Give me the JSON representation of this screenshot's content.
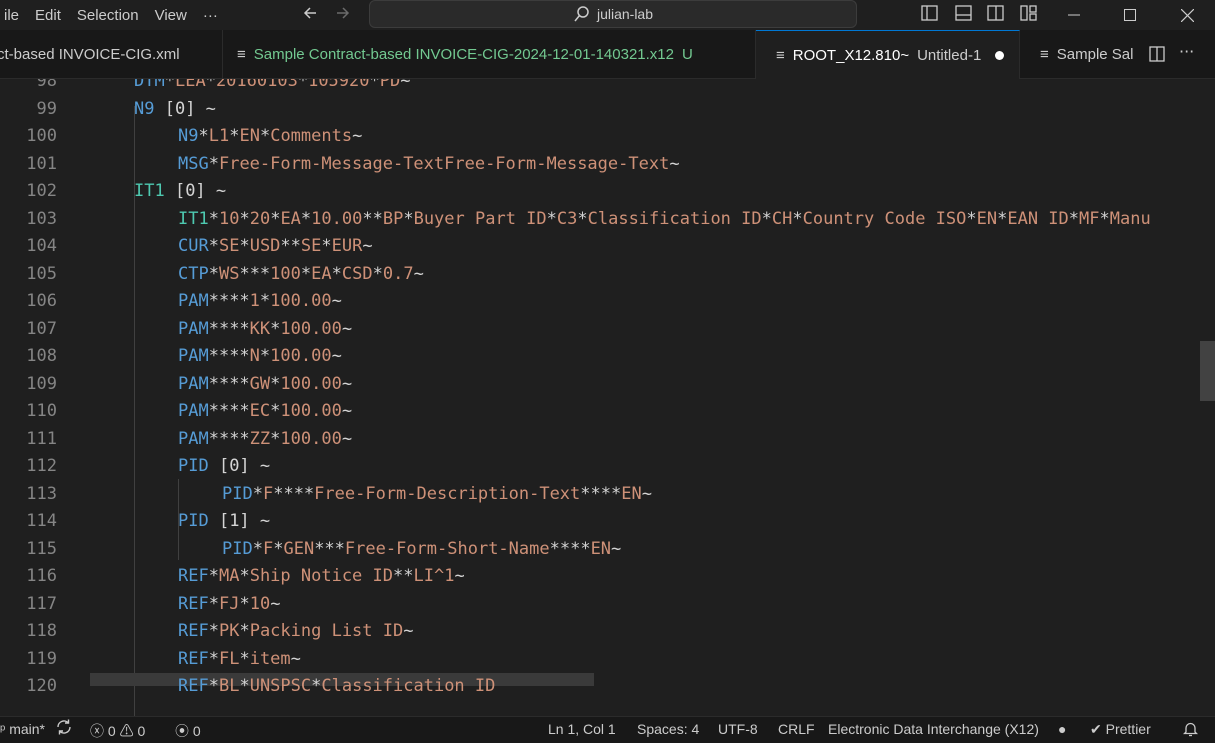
{
  "menu": {
    "file": "ile",
    "edit": "Edit",
    "selection": "Selection",
    "view": "View",
    "more": "···"
  },
  "search": {
    "text": "julian-lab"
  },
  "tabs": [
    {
      "label": "ct-based INVOICE-CIG.xml",
      "color": "#cccccc"
    },
    {
      "label": "Sample Contract-based INVOICE-CIG-2024-12-01-140321.x12",
      "badge": "U",
      "color": "#73c991"
    },
    {
      "label": "ROOT_X12.810~",
      "sub": "Untitled-1",
      "color": "#ffffff"
    },
    {
      "label": "Sample Sal",
      "color": "#cccccc"
    }
  ],
  "editor": {
    "lines": [
      {
        "n": "98",
        "segs": [
          [
            "seg",
            "DTM"
          ],
          [
            "sep",
            "*"
          ],
          [
            "tok",
            "LEA"
          ],
          [
            "sep",
            "*"
          ],
          [
            "tok",
            "20160103"
          ],
          [
            "sep",
            "*"
          ],
          [
            "tok",
            "105920"
          ],
          [
            "sep",
            "*"
          ],
          [
            "tok",
            "PD"
          ],
          [
            "sep",
            "~"
          ]
        ]
      },
      {
        "n": "99",
        "segs": [
          [
            "seg",
            "N9"
          ],
          [
            "sep",
            " [0] ~"
          ]
        ]
      },
      {
        "n": "100",
        "segs": [
          [
            "seg",
            "N9"
          ],
          [
            "sep",
            "*"
          ],
          [
            "tok",
            "L1"
          ],
          [
            "sep",
            "*"
          ],
          [
            "tok",
            "EN"
          ],
          [
            "sep",
            "*"
          ],
          [
            "tok",
            "Comments"
          ],
          [
            "sep",
            "~"
          ]
        ]
      },
      {
        "n": "101",
        "segs": [
          [
            "seg",
            "MSG"
          ],
          [
            "sep",
            "*"
          ],
          [
            "tok",
            "Free-Form-Message-TextFree-Form-Message-Text"
          ],
          [
            "sep",
            "~"
          ]
        ]
      },
      {
        "n": "102",
        "segs": [
          [
            "id",
            "IT1"
          ],
          [
            "sep",
            " [0] ~"
          ]
        ]
      },
      {
        "n": "103",
        "segs": [
          [
            "id",
            "IT1"
          ],
          [
            "sep",
            "*"
          ],
          [
            "tok",
            "10"
          ],
          [
            "sep",
            "*"
          ],
          [
            "tok",
            "20"
          ],
          [
            "sep",
            "*"
          ],
          [
            "tok",
            "EA"
          ],
          [
            "sep",
            "*"
          ],
          [
            "tok",
            "10.00"
          ],
          [
            "sep",
            "**"
          ],
          [
            "tok",
            "BP"
          ],
          [
            "sep",
            "*"
          ],
          [
            "tok",
            "Buyer Part ID"
          ],
          [
            "sep",
            "*"
          ],
          [
            "tok",
            "C3"
          ],
          [
            "sep",
            "*"
          ],
          [
            "tok",
            "Classification ID"
          ],
          [
            "sep",
            "*"
          ],
          [
            "tok",
            "CH"
          ],
          [
            "sep",
            "*"
          ],
          [
            "tok",
            "Country Code ISO"
          ],
          [
            "sep",
            "*"
          ],
          [
            "tok",
            "EN"
          ],
          [
            "sep",
            "*"
          ],
          [
            "tok",
            "EAN ID"
          ],
          [
            "sep",
            "*"
          ],
          [
            "tok",
            "MF"
          ],
          [
            "sep",
            "*"
          ],
          [
            "tok",
            "Manu"
          ]
        ]
      },
      {
        "n": "104",
        "segs": [
          [
            "seg",
            "CUR"
          ],
          [
            "sep",
            "*"
          ],
          [
            "tok",
            "SE"
          ],
          [
            "sep",
            "*"
          ],
          [
            "tok",
            "USD"
          ],
          [
            "sep",
            "**"
          ],
          [
            "tok",
            "SE"
          ],
          [
            "sep",
            "*"
          ],
          [
            "tok",
            "EUR"
          ],
          [
            "sep",
            "~"
          ]
        ]
      },
      {
        "n": "105",
        "segs": [
          [
            "seg",
            "CTP"
          ],
          [
            "sep",
            "*"
          ],
          [
            "tok",
            "WS"
          ],
          [
            "sep",
            "***"
          ],
          [
            "tok",
            "100"
          ],
          [
            "sep",
            "*"
          ],
          [
            "tok",
            "EA"
          ],
          [
            "sep",
            "*"
          ],
          [
            "tok",
            "CSD"
          ],
          [
            "sep",
            "*"
          ],
          [
            "tok",
            "0.7"
          ],
          [
            "sep",
            "~"
          ]
        ]
      },
      {
        "n": "106",
        "segs": [
          [
            "seg",
            "PAM"
          ],
          [
            "sep",
            "****"
          ],
          [
            "tok",
            "1"
          ],
          [
            "sep",
            "*"
          ],
          [
            "tok",
            "100.00"
          ],
          [
            "sep",
            "~"
          ]
        ]
      },
      {
        "n": "107",
        "segs": [
          [
            "seg",
            "PAM"
          ],
          [
            "sep",
            "****"
          ],
          [
            "tok",
            "KK"
          ],
          [
            "sep",
            "*"
          ],
          [
            "tok",
            "100.00"
          ],
          [
            "sep",
            "~"
          ]
        ]
      },
      {
        "n": "108",
        "segs": [
          [
            "seg",
            "PAM"
          ],
          [
            "sep",
            "****"
          ],
          [
            "tok",
            "N"
          ],
          [
            "sep",
            "*"
          ],
          [
            "tok",
            "100.00"
          ],
          [
            "sep",
            "~"
          ]
        ]
      },
      {
        "n": "109",
        "segs": [
          [
            "seg",
            "PAM"
          ],
          [
            "sep",
            "****"
          ],
          [
            "tok",
            "GW"
          ],
          [
            "sep",
            "*"
          ],
          [
            "tok",
            "100.00"
          ],
          [
            "sep",
            "~"
          ]
        ]
      },
      {
        "n": "110",
        "segs": [
          [
            "seg",
            "PAM"
          ],
          [
            "sep",
            "****"
          ],
          [
            "tok",
            "EC"
          ],
          [
            "sep",
            "*"
          ],
          [
            "tok",
            "100.00"
          ],
          [
            "sep",
            "~"
          ]
        ]
      },
      {
        "n": "111",
        "segs": [
          [
            "seg",
            "PAM"
          ],
          [
            "sep",
            "****"
          ],
          [
            "tok",
            "ZZ"
          ],
          [
            "sep",
            "*"
          ],
          [
            "tok",
            "100.00"
          ],
          [
            "sep",
            "~"
          ]
        ]
      },
      {
        "n": "112",
        "segs": [
          [
            "seg",
            "PID"
          ],
          [
            "sep",
            " [0] ~"
          ]
        ]
      },
      {
        "n": "113",
        "segs": [
          [
            "seg",
            "PID"
          ],
          [
            "sep",
            "*"
          ],
          [
            "tok",
            "F"
          ],
          [
            "sep",
            "****"
          ],
          [
            "tok",
            "Free-Form-Description-Text"
          ],
          [
            "sep",
            "****"
          ],
          [
            "tok",
            "EN"
          ],
          [
            "sep",
            "~"
          ]
        ]
      },
      {
        "n": "114",
        "segs": [
          [
            "seg",
            "PID"
          ],
          [
            "sep",
            " [1] ~"
          ]
        ]
      },
      {
        "n": "115",
        "segs": [
          [
            "seg",
            "PID"
          ],
          [
            "sep",
            "*"
          ],
          [
            "tok",
            "F"
          ],
          [
            "sep",
            "*"
          ],
          [
            "tok",
            "GEN"
          ],
          [
            "sep",
            "***"
          ],
          [
            "tok",
            "Free-Form-Short-Name"
          ],
          [
            "sep",
            "****"
          ],
          [
            "tok",
            "EN"
          ],
          [
            "sep",
            "~"
          ]
        ]
      },
      {
        "n": "116",
        "segs": [
          [
            "seg",
            "REF"
          ],
          [
            "sep",
            "*"
          ],
          [
            "tok",
            "MA"
          ],
          [
            "sep",
            "*"
          ],
          [
            "tok",
            "Ship Notice ID"
          ],
          [
            "sep",
            "**"
          ],
          [
            "tok",
            "LI^1"
          ],
          [
            "sep",
            "~"
          ]
        ]
      },
      {
        "n": "117",
        "segs": [
          [
            "seg",
            "REF"
          ],
          [
            "sep",
            "*"
          ],
          [
            "tok",
            "FJ"
          ],
          [
            "sep",
            "*"
          ],
          [
            "tok",
            "10"
          ],
          [
            "sep",
            "~"
          ]
        ]
      },
      {
        "n": "118",
        "segs": [
          [
            "seg",
            "REF"
          ],
          [
            "sep",
            "*"
          ],
          [
            "tok",
            "PK"
          ],
          [
            "sep",
            "*"
          ],
          [
            "tok",
            "Packing List ID"
          ],
          [
            "sep",
            "~"
          ]
        ]
      },
      {
        "n": "119",
        "segs": [
          [
            "seg",
            "REF"
          ],
          [
            "sep",
            "*"
          ],
          [
            "tok",
            "FL"
          ],
          [
            "sep",
            "*"
          ],
          [
            "tok",
            "item"
          ],
          [
            "sep",
            "~"
          ]
        ]
      },
      {
        "n": "120",
        "segs": [
          [
            "seg",
            "REF"
          ],
          [
            "sep",
            "*"
          ],
          [
            "tok",
            "BL"
          ],
          [
            "sep",
            "*"
          ],
          [
            "tok",
            "UNSPSC"
          ],
          [
            "sep",
            "*"
          ],
          [
            "tok",
            "Classification ID"
          ]
        ]
      }
    ]
  },
  "status": {
    "branch": "main*",
    "errors": "0",
    "warnings": "0",
    "ports": "0",
    "position": "Ln 1, Col 1",
    "spaces": "Spaces: 4",
    "encoding": "UTF-8",
    "eol": "CRLF",
    "language": "Electronic Data Interchange (X12)",
    "formatter": "Prettier"
  },
  "colors": {
    "segment": "#569cd6",
    "loop": "#4ec9b0",
    "value": "#ce9178",
    "accent": "#0078d4"
  }
}
